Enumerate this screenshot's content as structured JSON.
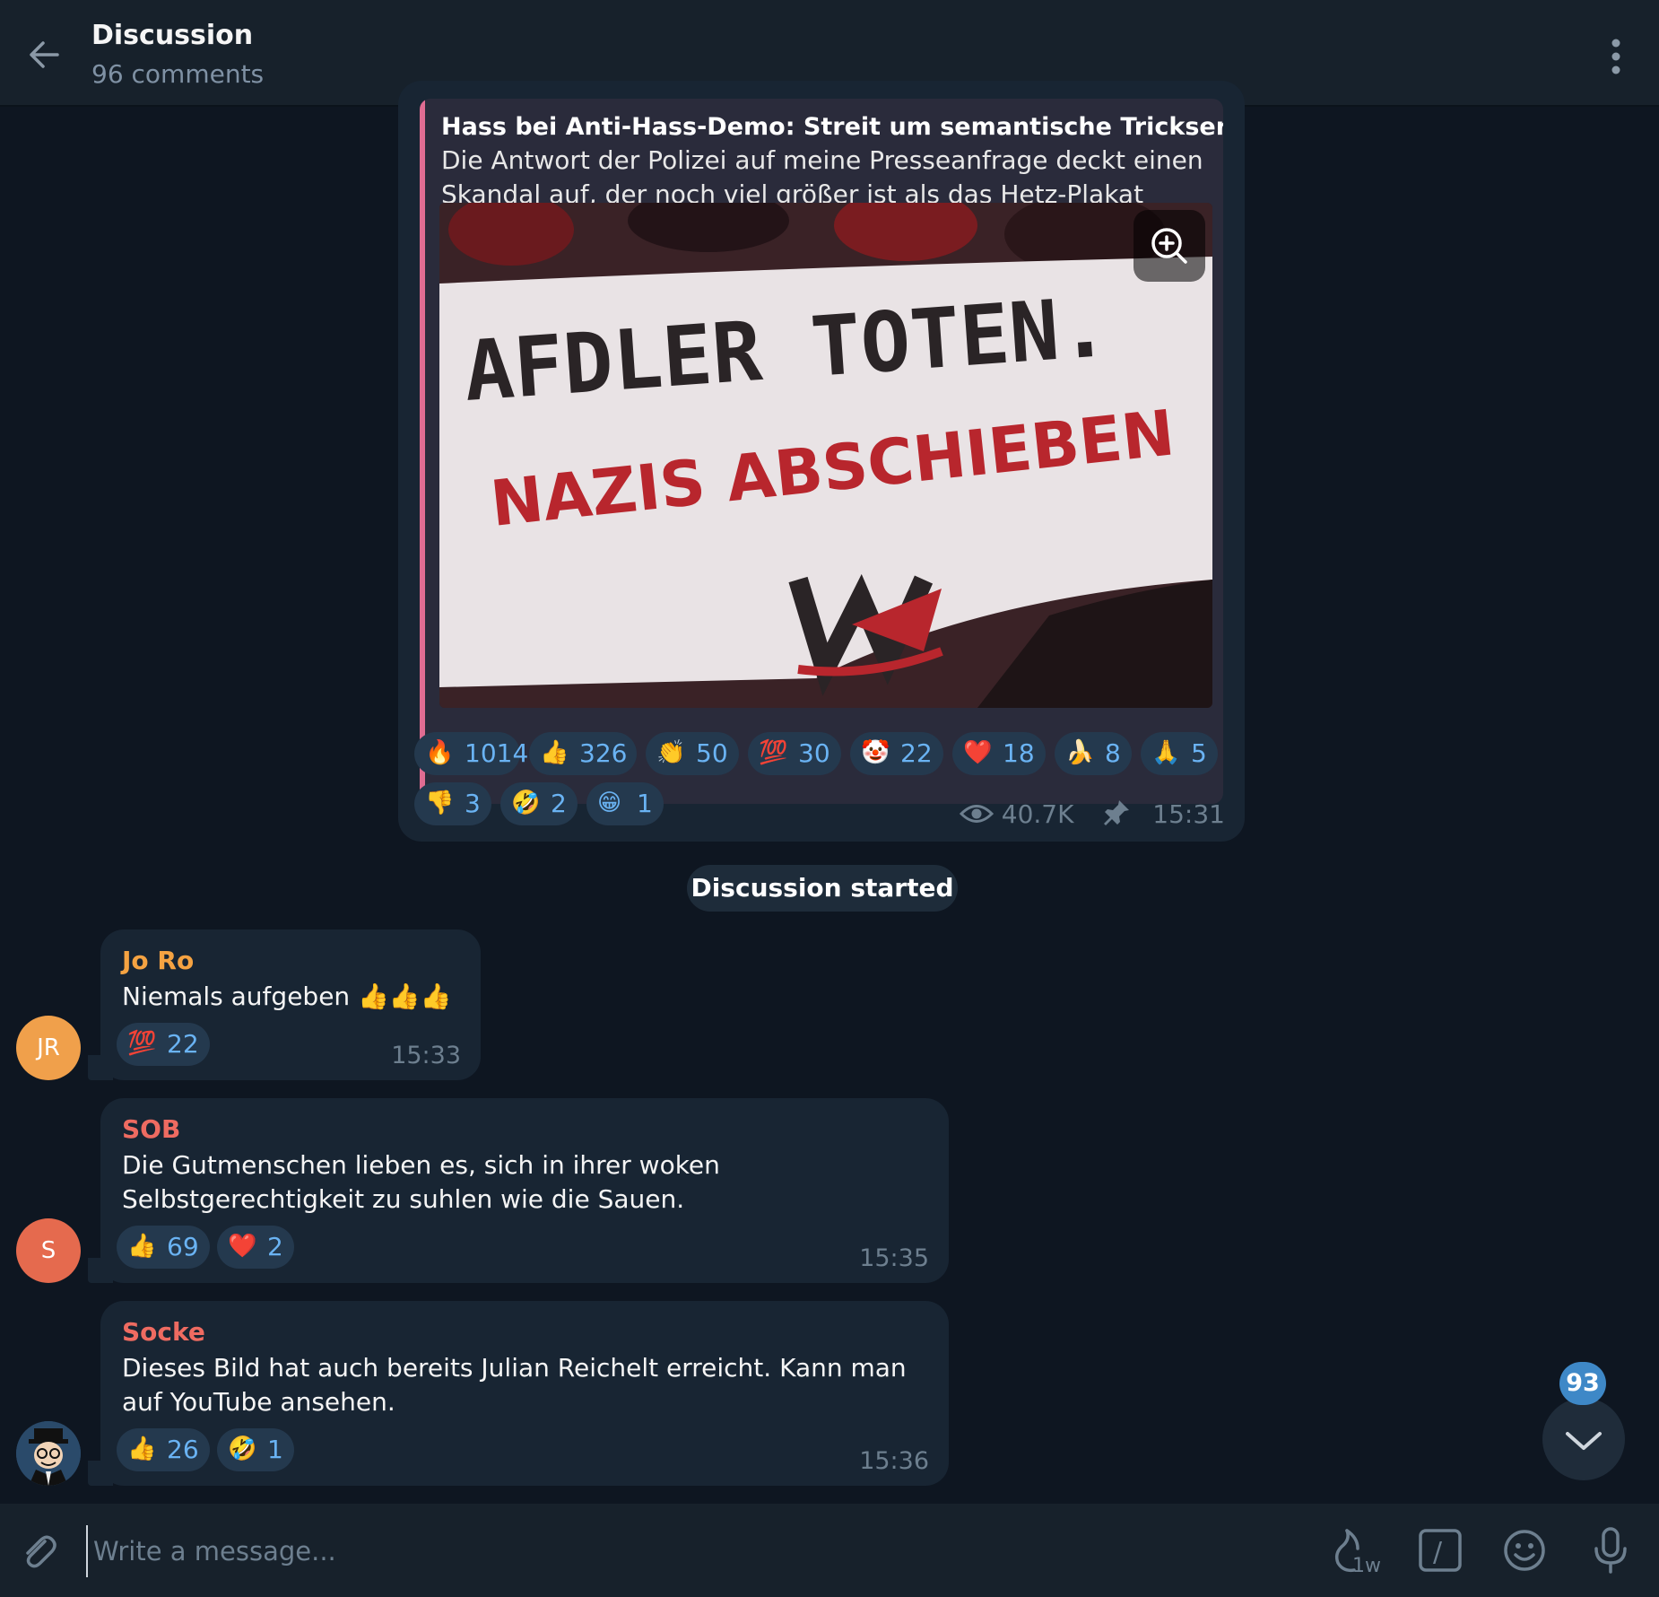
{
  "header": {
    "title": "Discussion",
    "subtitle": "96 comments"
  },
  "post": {
    "quote_title": "Hass bei Anti-Hass-Demo: Streit um semantische Trickserei.",
    "quote_text": "Die Antwort der Polizei auf meine Presseanfrage deckt einen Skandal auf, der noch viel größer ist als das Hetz-Plakat selbst. U...",
    "banner_line1": "AFDLER TOTEN.",
    "banner_line2": "NAZIS ABSCHIEBEN",
    "reactions": [
      {
        "emoji": "🔥",
        "count": "1014"
      },
      {
        "emoji": "👍",
        "count": "326"
      },
      {
        "emoji": "👏",
        "count": "50"
      },
      {
        "emoji": "💯",
        "count": "30"
      },
      {
        "emoji": "🤡",
        "count": "22"
      },
      {
        "emoji": "❤️",
        "count": "18"
      },
      {
        "emoji": "🍌",
        "count": "8"
      },
      {
        "emoji": "🙏",
        "count": "5"
      },
      {
        "emoji": "👎",
        "count": "3"
      },
      {
        "emoji": "🤣",
        "count": "2"
      },
      {
        "emoji": "😁",
        "count": "1"
      }
    ],
    "views": "40.7K",
    "time": "15:31"
  },
  "service_message": "Discussion started",
  "comments": [
    {
      "initials": "JR",
      "author": "Jo Ro",
      "author_color": "#f5a342",
      "avatar_color": "#f0a04b",
      "text": "Niemals aufgeben 👍👍👍",
      "reactions": [
        {
          "emoji": "💯",
          "count": "22"
        }
      ],
      "time": "15:33"
    },
    {
      "initials": "S",
      "author": "SOB",
      "author_color": "#ee6b61",
      "avatar_color": "#e56a4e",
      "text": "Die Gutmenschen lieben es, sich in ihrer woken Selbstgerechtigkeit zu suhlen wie die Sauen.",
      "reactions": [
        {
          "emoji": "👍",
          "count": "69"
        },
        {
          "emoji": "❤️",
          "count": "2"
        }
      ],
      "time": "15:35"
    },
    {
      "initials": "",
      "author": "Socke",
      "author_color": "#ee6b61",
      "avatar_color": "#2a4a6a",
      "text": "Dieses Bild hat auch bereits Julian Reichelt erreicht. Kann man auf YouTube ansehen.",
      "reactions": [
        {
          "emoji": "👍",
          "count": "26"
        },
        {
          "emoji": "🤣",
          "count": "1"
        }
      ],
      "time": "15:36"
    }
  ],
  "scroll_down": {
    "unread": "93"
  },
  "composer": {
    "placeholder": "Write a message...",
    "timer_label": "1w",
    "command_label": "/"
  },
  "colors": {
    "background": "#0e1621",
    "bubble": "#182533",
    "accent": "#6ab3f3",
    "quote_bar": "#e06c92"
  }
}
